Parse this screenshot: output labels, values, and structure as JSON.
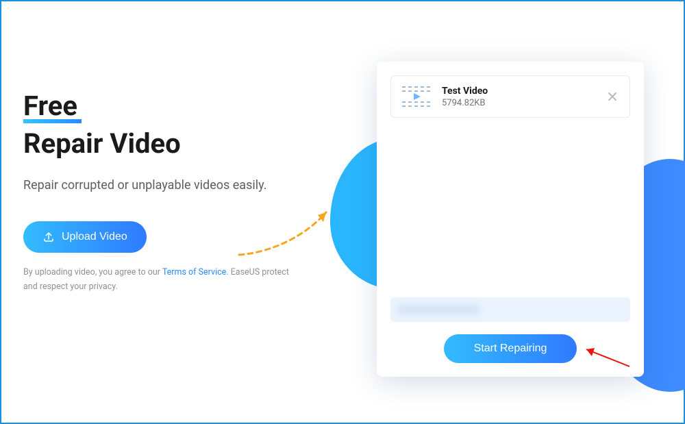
{
  "headline": {
    "free": "Free",
    "repair": "Repair Video"
  },
  "subhead": "Repair corrupted or unplayable videos easily.",
  "upload_button_label": "Upload Video",
  "terms": {
    "prefix": "By uploading video, you agree to our ",
    "link": "Terms of Service",
    "suffix": ". EaseUS protect and respect your privacy."
  },
  "file": {
    "name": "Test Video",
    "size": "5794.82KB"
  },
  "start_button_label": "Start Repairing"
}
